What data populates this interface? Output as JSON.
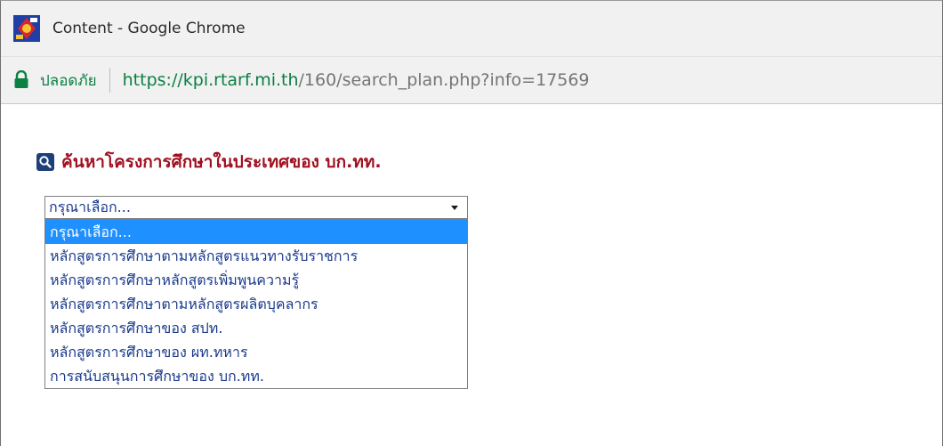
{
  "window": {
    "title": "Content - Google Chrome"
  },
  "addressbar": {
    "secure_label": "ปลอดภัย",
    "url_scheme": "https://",
    "url_domain": "kpi.rtarf.mi.th",
    "url_path": "/160/search_plan.php?info=17569"
  },
  "page": {
    "heading": "ค้นหาโครงการศึกษาในประเทศของ บก.ทท."
  },
  "select": {
    "value": "กรุณาเลือก...",
    "options": [
      "กรุณาเลือก...",
      "หลักสูตรการศึกษาตามหลักสูตรแนวทางรับราชการ",
      "หลักสูตรการศึกษาหลักสูตรเพิ่มพูนความรู้",
      "หลักสูตรการศึกษาตามหลักสูตรผลิตบุคลากร",
      "หลักสูตรการศึกษาของ สปท.",
      "หลักสูตรการศึกษาของ ผท.ทหาร",
      "การสนับสนุนการศึกษาของ บก.ทท."
    ],
    "selected_index": 0
  },
  "colors": {
    "heading": "#a01020",
    "option_text": "#1a3a8c",
    "selected_bg": "#1e90ff",
    "secure_green": "#0b8043"
  },
  "icons": {
    "app": "rtarf-emblem-icon",
    "lock": "lock-icon",
    "search": "search-icon",
    "dropdown": "chevron-down-icon"
  }
}
